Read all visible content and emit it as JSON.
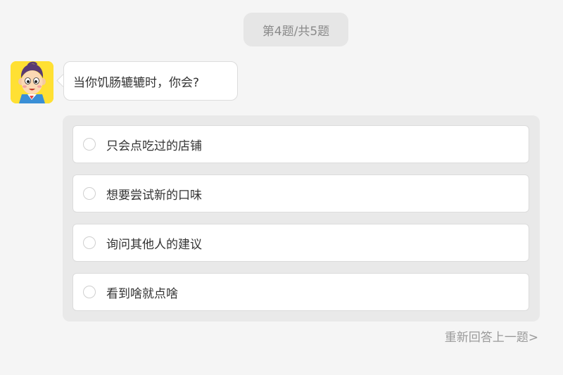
{
  "progress": {
    "text": "第4题/共5题"
  },
  "question": {
    "text": "当你饥肠辘辘时，你会?"
  },
  "options": [
    {
      "label": "只会点吃过的店铺",
      "selected": false
    },
    {
      "label": "想要尝试新的口味",
      "selected": false
    },
    {
      "label": "询问其他人的建议",
      "selected": false
    },
    {
      "label": "看到啥就点啥",
      "selected": false
    }
  ],
  "footer": {
    "redo_label": "重新回答上一题>"
  },
  "colors": {
    "background": "#f5f5f5",
    "avatar_bg": "#ffe033",
    "panel_bg": "#e9e9e9",
    "pill_bg": "#e6e6e6"
  }
}
